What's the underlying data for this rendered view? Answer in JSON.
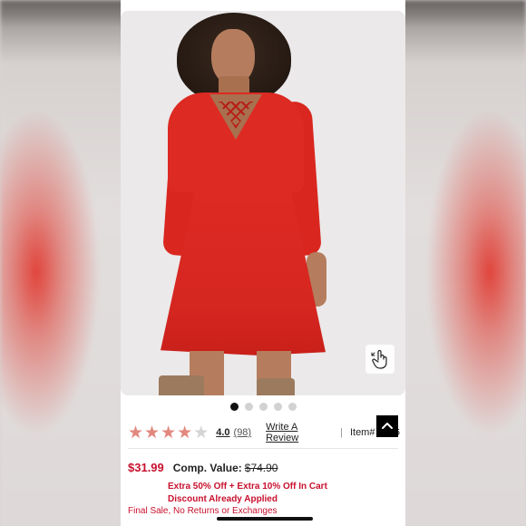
{
  "product": {
    "image_alt": "Red long-sleeve lace-up skater dress",
    "carousel": {
      "total": 5,
      "active_index": 0
    },
    "rating": {
      "value": "4.0",
      "stars": 4,
      "max_stars": 5,
      "review_count": "(98)"
    },
    "write_review_label": "Write A Review",
    "separator": "|",
    "item_number": "Item# 1206",
    "price": "$31.99",
    "comp_value_label": "Comp. Value:",
    "comp_value": "$74.90",
    "promo_line_1": "Extra 50% Off + Extra 10% Off In Cart",
    "promo_line_2": "Discount Already Applied",
    "final_sale": "Final Sale, No Returns or Exchanges"
  },
  "icons": {
    "zoom": "tap-zoom-icon",
    "scroll_top": "chevron-up-icon",
    "star": "star-icon"
  },
  "colors": {
    "price_red": "#c8102e",
    "star_filled": "#e2887e",
    "star_empty": "#d4d4d4",
    "dress_red": "#dd2a22"
  }
}
